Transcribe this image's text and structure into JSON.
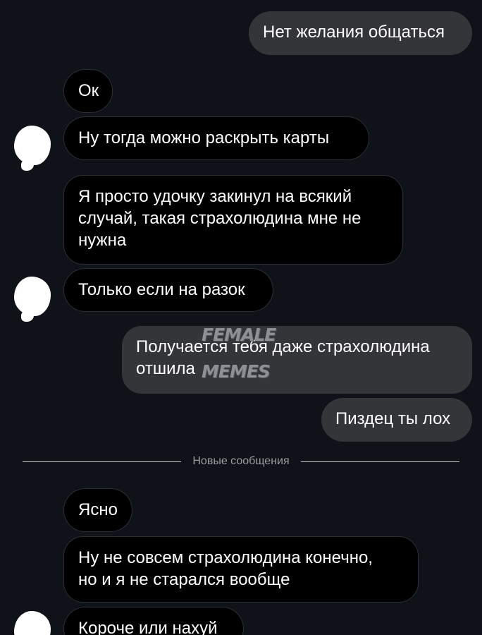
{
  "messages": [
    {
      "side": "out",
      "text": "Нет желания общаться"
    },
    {
      "side": "in",
      "text": "Ок"
    },
    {
      "side": "in",
      "text": "Ну тогда можно раскрыть карты"
    },
    {
      "side": "in",
      "text": "Я просто удочку закинул на всякий\nслучай, такая страхолюдина мне не\nнужна"
    },
    {
      "side": "in",
      "text": "Только если на разок"
    },
    {
      "side": "out",
      "text": "Получается тебя даже страхолюдина\nотшила"
    },
    {
      "side": "out",
      "text": "Пиздец ты лох"
    },
    {
      "side": "in",
      "text": "Ясно"
    },
    {
      "side": "in",
      "text": "Ну не совсем страхолюдина конечно,\nно и я не старался вообще"
    },
    {
      "side": "in",
      "text": "Короче или нахуй"
    }
  ],
  "divider": {
    "label": "Новые сообщения"
  },
  "watermark": {
    "line1": "FEMALE",
    "line2": "MEMES"
  },
  "colors": {
    "background": "#0f1218",
    "incoming_bubble": "#000000",
    "incoming_border": "#2c2f35",
    "outgoing_bubble": "#333539",
    "divider_text": "#9a9ca1"
  }
}
